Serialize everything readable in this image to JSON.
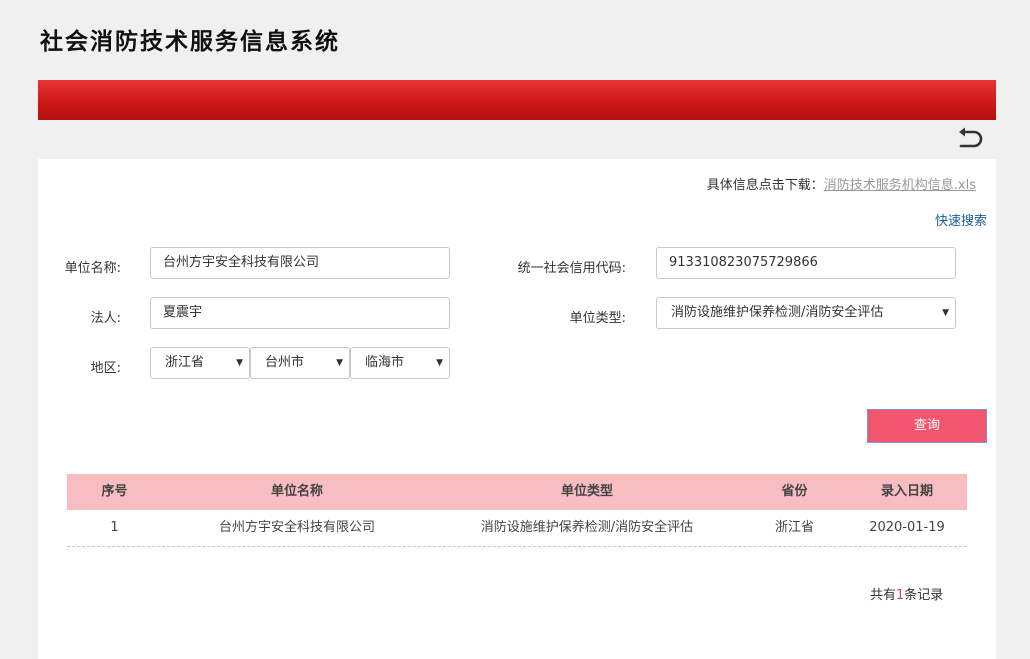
{
  "app": {
    "title": "社会消防技术服务信息系统"
  },
  "download": {
    "prefix": "具体信息点击下载：",
    "link": "消防技术服务机构信息.xls"
  },
  "quick_search": "快速搜索",
  "form": {
    "unit_name": {
      "label": "单位名称:",
      "value": "台州方宇安全科技有限公司"
    },
    "credit_code": {
      "label": "统一社会信用代码:",
      "value": "913310823075729866"
    },
    "legal_person": {
      "label": "法人:",
      "value": "夏震宇"
    },
    "unit_type": {
      "label": "单位类型:",
      "value": "消防设施维护保养检测/消防安全评估"
    },
    "region": {
      "label": "地区:",
      "province": "浙江省",
      "city": "台州市",
      "district": "临海市"
    },
    "query_button": "查询"
  },
  "table": {
    "headers": [
      "序号",
      "单位名称",
      "单位类型",
      "省份",
      "录入日期"
    ],
    "rows": [
      [
        "1",
        "台州方宇安全科技有限公司",
        "消防设施维护保养检测/消防安全评估",
        "浙江省",
        "2020-01-19"
      ]
    ]
  },
  "footer": {
    "prefix": "共有",
    "count": "1",
    "suffix": "条记录"
  },
  "icons": {
    "back": "undo-arrow-icon",
    "caret": "triangle-down-icon"
  },
  "colors": {
    "header_bar": "#d01818",
    "table_header": "#f7bdc0",
    "query_button": "#f2566e",
    "link": "#1a5e9a"
  }
}
